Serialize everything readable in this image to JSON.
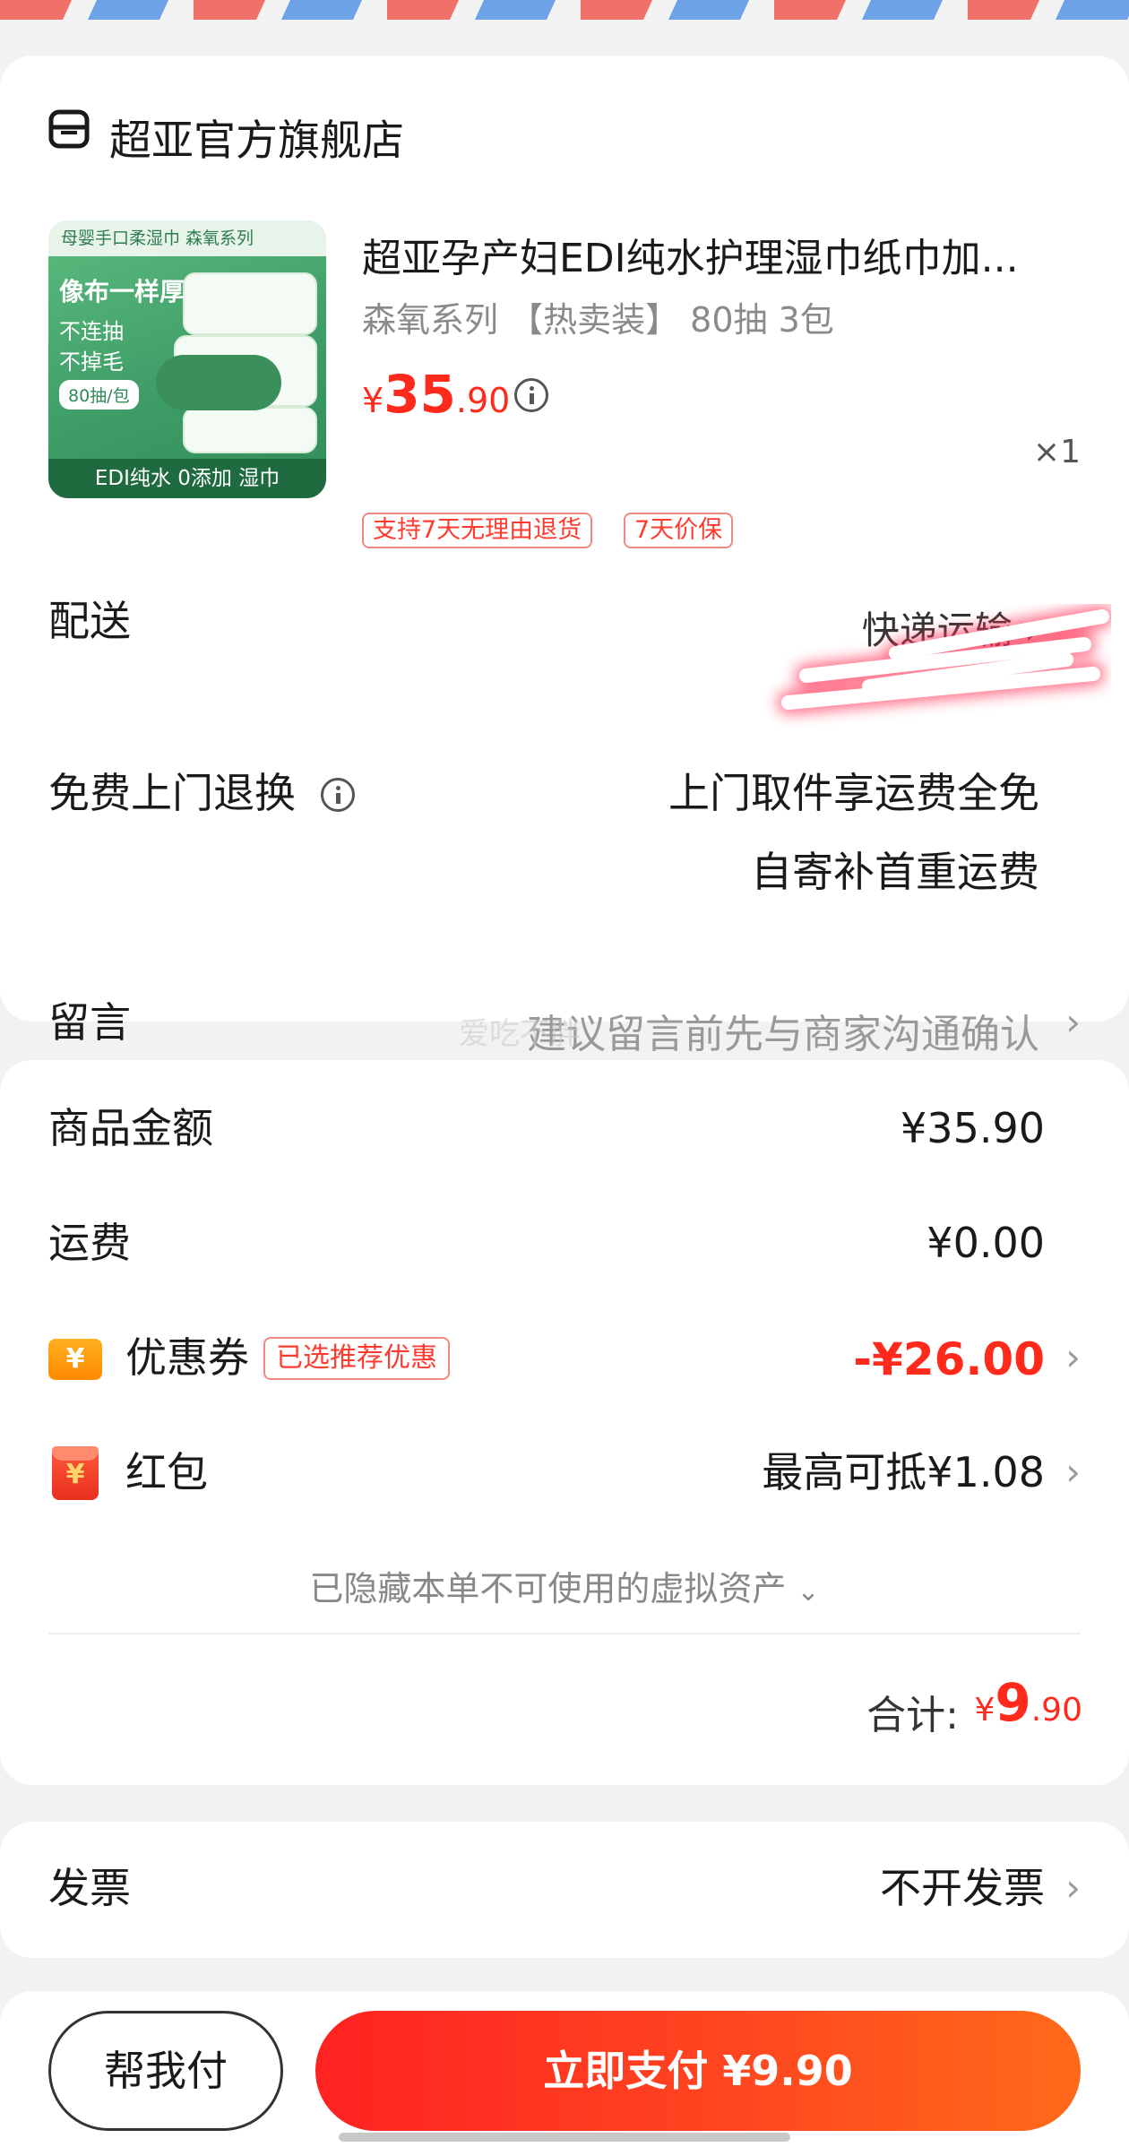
{
  "store": {
    "name": "超亚官方旗舰店",
    "icon": "store-icon"
  },
  "product": {
    "title": "超亚孕产妇EDI纯水护理湿巾纸巾加...",
    "spec": "森氧系列 【热卖装】 80抽 3包",
    "price_currency": "¥",
    "price_int": "35",
    "price_dec": ".90",
    "quantity": "×1",
    "tags": [
      "支持7天无理由退货",
      "7天价保"
    ],
    "thumb": {
      "top_text": "母婴手口柔湿巾  森氧系列",
      "headline": "像布一样厚",
      "line1": "不连抽",
      "line2": "不掉毛",
      "pill": "80抽/包",
      "bottom_text": "EDI纯水  0添加  湿巾"
    }
  },
  "delivery": {
    "label": "配送",
    "value": "快递运输 ›"
  },
  "return_service": {
    "label": "免费上门退换",
    "line1": "上门取件享运费全免",
    "line2": "自寄补首重运费"
  },
  "note": {
    "label": "留言",
    "placeholder": "建议留言前先与商家沟通确认"
  },
  "watermark": "爱吃不胖",
  "totals": {
    "goods_label": "商品金额",
    "goods_value": "¥35.90",
    "shipping_label": "运费",
    "shipping_value": "¥0.00",
    "coupon_label": "优惠券",
    "coupon_badge": "已选推荐优惠",
    "coupon_value": "-¥26.00",
    "redpacket_label": "红包",
    "redpacket_value": "最高可抵¥1.08",
    "hidden_assets": "已隐藏本单不可使用的虚拟资产",
    "total_label": "合计:",
    "total_currency": "¥",
    "total_int": "9",
    "total_dec": ".90"
  },
  "invoice": {
    "label": "发票",
    "value": "不开发票"
  },
  "actions": {
    "help_pay": "帮我付",
    "pay_now": "立即支付 ¥9.90"
  },
  "colors": {
    "accent_red": "#ff2a1c",
    "pay_gradient_start": "#ff2222",
    "pay_gradient_end": "#ff6a1a",
    "background": "#f2f2f2"
  }
}
